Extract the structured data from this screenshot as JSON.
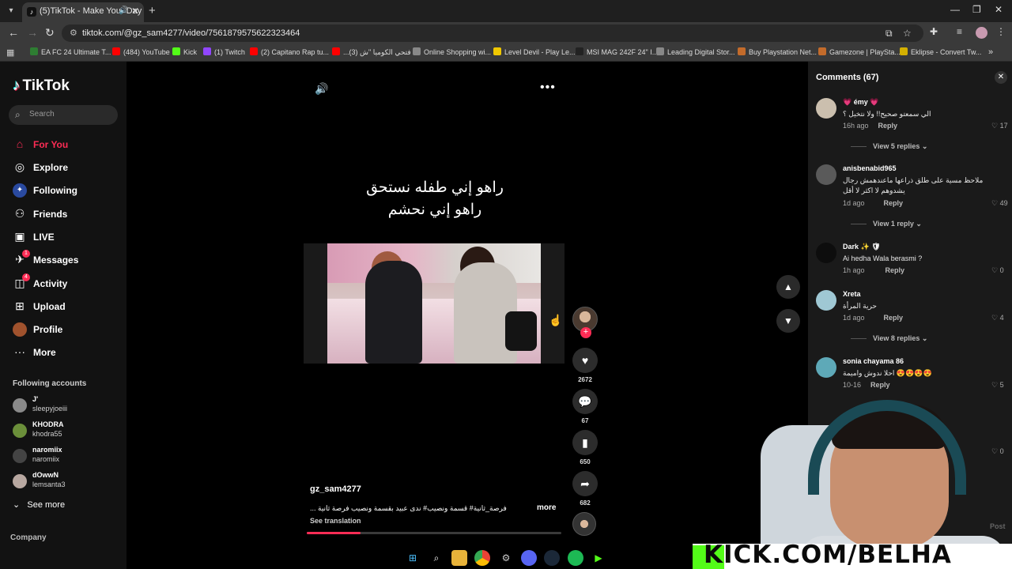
{
  "browser": {
    "tab_title": "(5)TikTok - Make Your Day",
    "url": "tiktok.com/@gz_sam4277/video/7561879575622323464",
    "bookmarks": [
      "EA FC 24 Ultimate T...",
      "(484) YouTube",
      "Kick",
      "(1) Twitch",
      "(2) Capitano Rap tu...",
      "...فتحي الكوميا \"ش (3)",
      "Online Shopping wi...",
      "Level Devil - Play Le...",
      "MSI MAG 242F 24\" I...",
      "Leading Digital Stor...",
      "Buy Playstation Net...",
      "Gamezone | PlaySta...",
      "Eklipse - Convert Tw..."
    ]
  },
  "sidebar": {
    "logo": "TikTok",
    "search_placeholder": "Search",
    "nav": [
      {
        "label": "For You",
        "icon": "home-icon"
      },
      {
        "label": "Explore",
        "icon": "compass-icon"
      },
      {
        "label": "Following",
        "icon": "following-icon"
      },
      {
        "label": "Friends",
        "icon": "friends-icon"
      },
      {
        "label": "LIVE",
        "icon": "live-icon"
      },
      {
        "label": "Messages",
        "icon": "messages-icon",
        "badge": "1"
      },
      {
        "label": "Activity",
        "icon": "activity-icon",
        "badge": "4"
      },
      {
        "label": "Upload",
        "icon": "upload-icon"
      },
      {
        "label": "Profile",
        "icon": "profile-icon"
      },
      {
        "label": "More",
        "icon": "more-icon"
      }
    ],
    "following_title": "Following accounts",
    "accounts": [
      {
        "name": "J'",
        "handle": "sleepyjoeiii"
      },
      {
        "name": "KHODRA",
        "handle": "khodra55"
      },
      {
        "name": "naromiix",
        "handle": "naromiix"
      },
      {
        "name": "dOwwN",
        "handle": "lemsanta3"
      }
    ],
    "see_more": "See more",
    "company": "Company"
  },
  "video": {
    "caption_line1": "راهو إني طفله نستحق",
    "caption_line2": "راهو إني نحشم",
    "author": "gz_sam4277",
    "description": "فرصة_ثانية# قسمة ونصيب# ندى عبيد بقسمة ونصيب فرصة ثانية ...",
    "more": "more",
    "see_translation": "See translation",
    "progress": 0.21,
    "likes": "2672",
    "comments": "67",
    "saves": "650",
    "shares": "682"
  },
  "comments": {
    "title": "Comments (67)",
    "reply_label": "Reply",
    "items": [
      {
        "user": "💗 émy 💗",
        "text": "الي سمعتو صحيح!! ولا نتخيل ؟",
        "time": "16h ago",
        "likes": "17",
        "views": "View 5 replies"
      },
      {
        "user": "anisbenabid965",
        "text": "ملاحظ مسية على طلق ذراعها ماعندهمش رجال يشدوهم لا اكثر لا أقل",
        "time": "1d ago",
        "likes": "49",
        "views": "View 1 reply"
      },
      {
        "user": "Dark ✨ 🛡",
        "text": "Ai hedha Wala berasmi ?",
        "time": "1h ago",
        "likes": "0",
        "views": ""
      },
      {
        "user": "Xreta",
        "text": "حرية المرأة",
        "time": "1d ago",
        "likes": "4",
        "views": "View 8 replies"
      },
      {
        "user": "sonia chayama 86",
        "text": "😍😍😍😍 احلا ندوش واميمة",
        "time": "10-16",
        "likes": "5",
        "views": ""
      }
    ],
    "extra_like": "0",
    "post_label": "Post"
  },
  "overlay": {
    "kick_text": "KICK.COM/BELHA"
  },
  "colors": {
    "accent": "#fe2c55",
    "kick_green": "#53fc18"
  }
}
